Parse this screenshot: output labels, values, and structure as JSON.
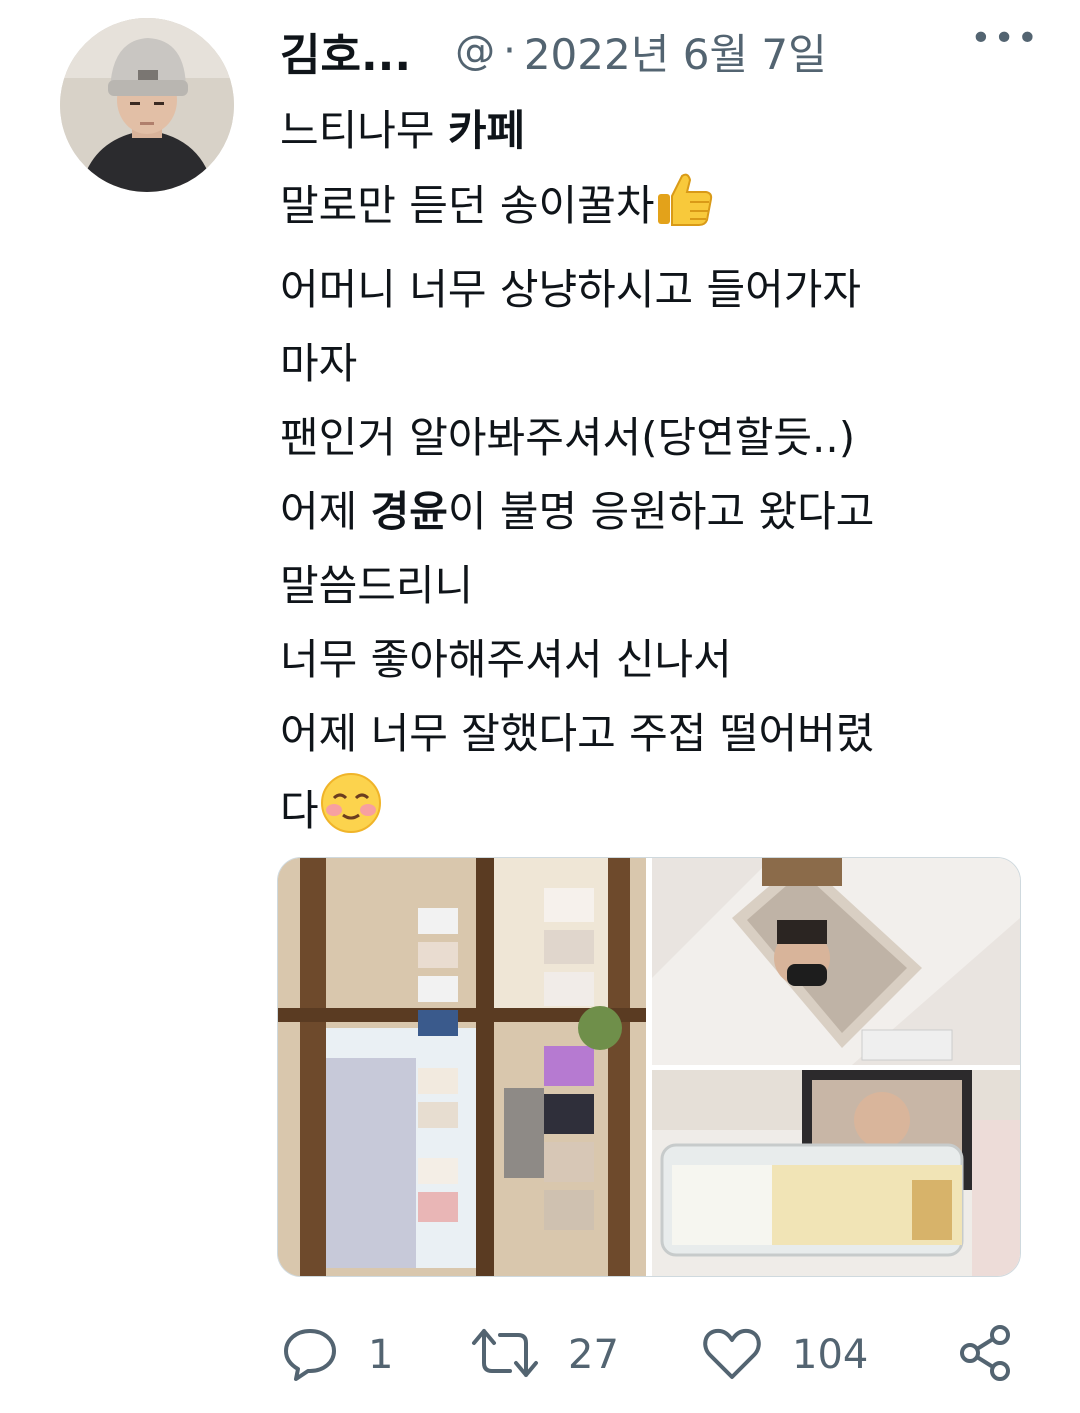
{
  "tweet": {
    "author_name": "김호...",
    "handle": "@",
    "separator": "·",
    "date": "2022년 6월 7일",
    "more_label": "•••",
    "lines": {
      "l1a": "느티나무 ",
      "l1b": "카페",
      "l2": "말로만 듣던 송이꿀차",
      "l3": "어머니 너무 상냥하시고 들어가자",
      "l4": "마자",
      "l5": "팬인거 알아봐주셔서(당연할듯..)",
      "l6a": "어제 ",
      "l6b": "경윤",
      "l6c": "이 불명 응원하고 왔다고",
      "l7": "말씀드리니",
      "l8": "너무 좋아해주셔서 신나서",
      "l9": "어제 너무 잘했다고 주접 떨어버렸",
      "l10": "다"
    },
    "emojis": {
      "thumbs_up": "thumbs-up-icon",
      "blush": "smiling-face-icon"
    }
  },
  "media": {
    "count": 3,
    "photos": [
      "photo-cafe-interior",
      "photo-hanging-poster",
      "photo-honey-tea-glass"
    ]
  },
  "actions": {
    "reply": {
      "icon": "reply-icon",
      "count": "1"
    },
    "retweet": {
      "icon": "retweet-icon",
      "count": "27"
    },
    "like": {
      "icon": "heart-icon",
      "count": "104"
    },
    "share": {
      "icon": "share-icon"
    }
  },
  "colors": {
    "text": "#0f1419",
    "secondary": "#536471",
    "border": "#cfd9de"
  }
}
